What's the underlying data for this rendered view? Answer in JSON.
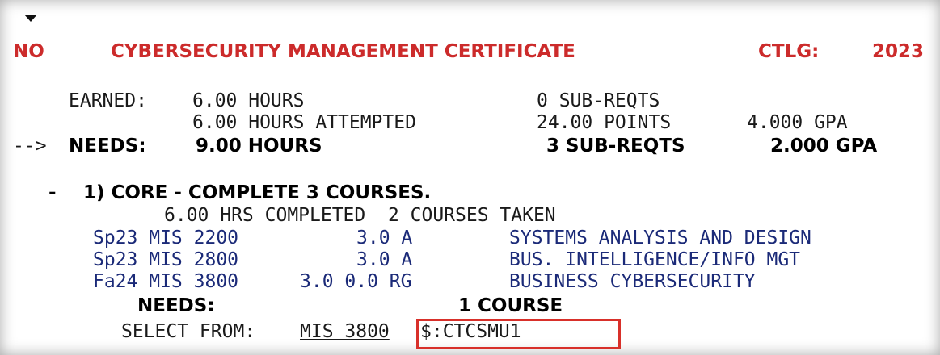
{
  "header": {
    "status": "NO",
    "title": "CYBERSECURITY MANAGEMENT CERTIFICATE",
    "catalog_label": "CTLG:",
    "catalog_year": "2023"
  },
  "earned": {
    "label": "EARNED:",
    "hours": "6.00 HOURS",
    "subreqts": "0 SUB-REQTS",
    "attempted": "6.00 HOURS ATTEMPTED",
    "points": "24.00 POINTS",
    "gpa": "4.000 GPA"
  },
  "needs": {
    "arrow": "-->",
    "label": "NEEDS:",
    "hours": "9.00 HOURS",
    "subreqts": "3 SUB-REQTS",
    "gpa": "2.000 GPA"
  },
  "requirement": {
    "marker": "-",
    "title": "1) CORE - COMPLETE 3 COURSES.",
    "summary": "6.00 HRS COMPLETED  2 COURSES TAKEN",
    "courses": [
      {
        "term_course": "Sp23 MIS 2200",
        "credit": "3.0 A",
        "title": "SYSTEMS ANALYSIS AND DESIGN"
      },
      {
        "term_course": "Sp23 MIS 2800",
        "credit": "3.0 A",
        "title": "BUS. INTELLIGENCE/INFO MGT"
      },
      {
        "term_course": "Fa24 MIS 3800",
        "credit": "3.0 0.0 RG",
        "title": "BUSINESS CYBERSECURITY"
      }
    ],
    "needs_label": "NEEDS:",
    "needs_value": "1 COURSE",
    "select_label": "SELECT FROM:",
    "select_course": "MIS 3800",
    "select_code": "$:CTCSMU1"
  },
  "colors": {
    "header_red": "#cc2b2b",
    "course_blue": "#1b2a78",
    "highlight_red": "#d8302a"
  }
}
